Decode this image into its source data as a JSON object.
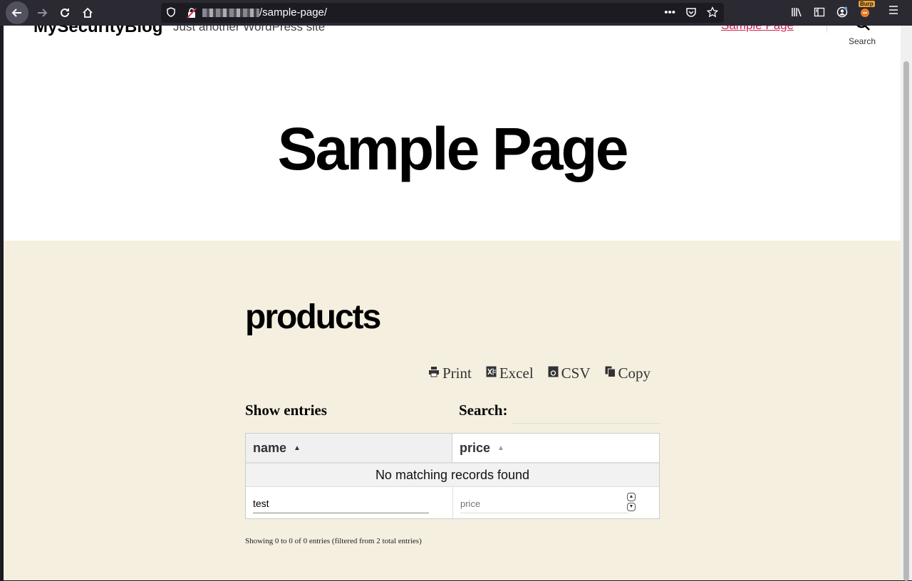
{
  "browser": {
    "url_path": "/sample-page/",
    "burp_label": "Burp"
  },
  "site": {
    "title": "MySecurityBlog",
    "tagline": "Just another WordPress site",
    "header_link": "Sample Page",
    "search_label": "Search"
  },
  "page": {
    "title": "Sample Page",
    "section_title": "products"
  },
  "buttons": {
    "print": "Print",
    "excel": "Excel",
    "csv": "CSV",
    "copy": "Copy"
  },
  "controls": {
    "show_entries": "Show entries",
    "search_label": "Search:"
  },
  "table": {
    "columns": [
      {
        "label": "name"
      },
      {
        "label": "price"
      }
    ],
    "empty_message": "No matching records found",
    "filters": {
      "name_value": "test",
      "price_placeholder": "price"
    }
  },
  "footer": {
    "info": "Showing 0 to 0 of 0 entries (filtered from 2 total entries)"
  }
}
